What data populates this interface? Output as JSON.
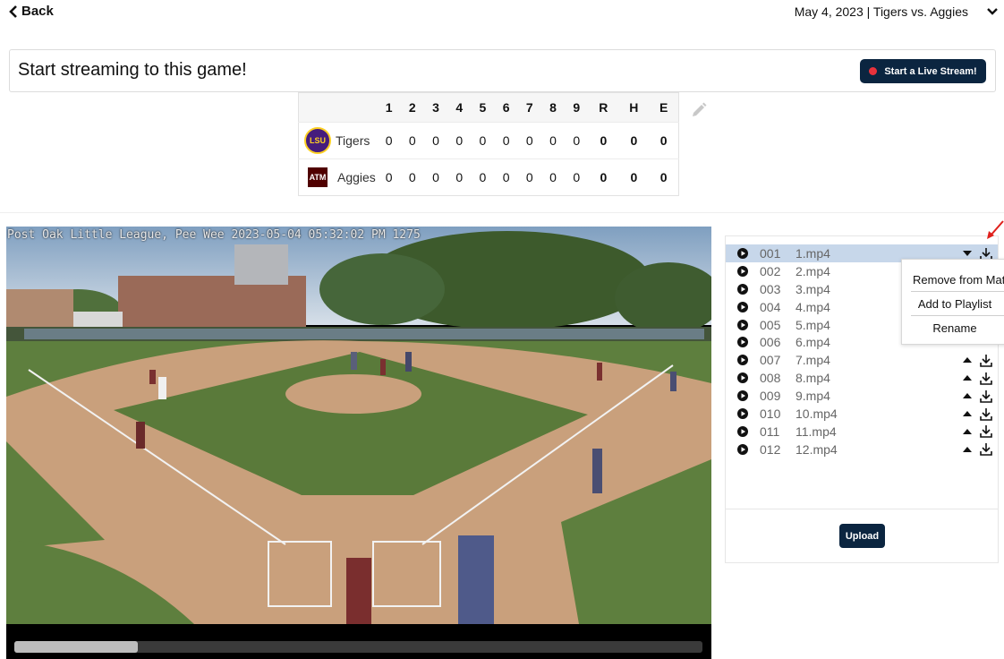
{
  "header": {
    "back_label": "Back",
    "game_selector": "May 4, 2023 | Tigers vs. Aggies"
  },
  "stream": {
    "prompt": "Start streaming to this game!",
    "button_label": "Start a Live Stream!"
  },
  "scoreboard": {
    "columns": [
      "1",
      "2",
      "3",
      "4",
      "5",
      "6",
      "7",
      "8",
      "9",
      "R",
      "H",
      "E"
    ],
    "teams": [
      {
        "name": "Tigers",
        "logo_text": "LSU",
        "scores": [
          "0",
          "0",
          "0",
          "0",
          "0",
          "0",
          "0",
          "0",
          "0",
          "0",
          "0",
          "0"
        ]
      },
      {
        "name": "Aggies",
        "logo_text": "ATM",
        "scores": [
          "0",
          "0",
          "0",
          "0",
          "0",
          "0",
          "0",
          "0",
          "0",
          "0",
          "0",
          "0"
        ]
      }
    ]
  },
  "video": {
    "overlay": "Post Oak Little League, Pee Wee 2023-05-04 05:32:02 PM  1275",
    "progress": 0.18
  },
  "files": {
    "items": [
      {
        "num": "001",
        "name": "1.mp4",
        "selected": true
      },
      {
        "num": "002",
        "name": "2.mp4"
      },
      {
        "num": "003",
        "name": "3.mp4"
      },
      {
        "num": "004",
        "name": "4.mp4"
      },
      {
        "num": "005",
        "name": "5.mp4"
      },
      {
        "num": "006",
        "name": "6.mp4"
      },
      {
        "num": "007",
        "name": "7.mp4"
      },
      {
        "num": "008",
        "name": "8.mp4"
      },
      {
        "num": "009",
        "name": "9.mp4"
      },
      {
        "num": "010",
        "name": "10.mp4"
      },
      {
        "num": "011",
        "name": "11.mp4"
      },
      {
        "num": "012",
        "name": "12.mp4"
      }
    ],
    "upload_label": "Upload"
  },
  "context_menu": {
    "items": [
      "Remove from Match",
      "Add to Playlist",
      "Rename"
    ]
  },
  "colors": {
    "brand_navy": "#0b2540",
    "live_red": "#e8323c",
    "selected_row": "#c7d7ea",
    "annotation_arrow": "#e0201c"
  }
}
